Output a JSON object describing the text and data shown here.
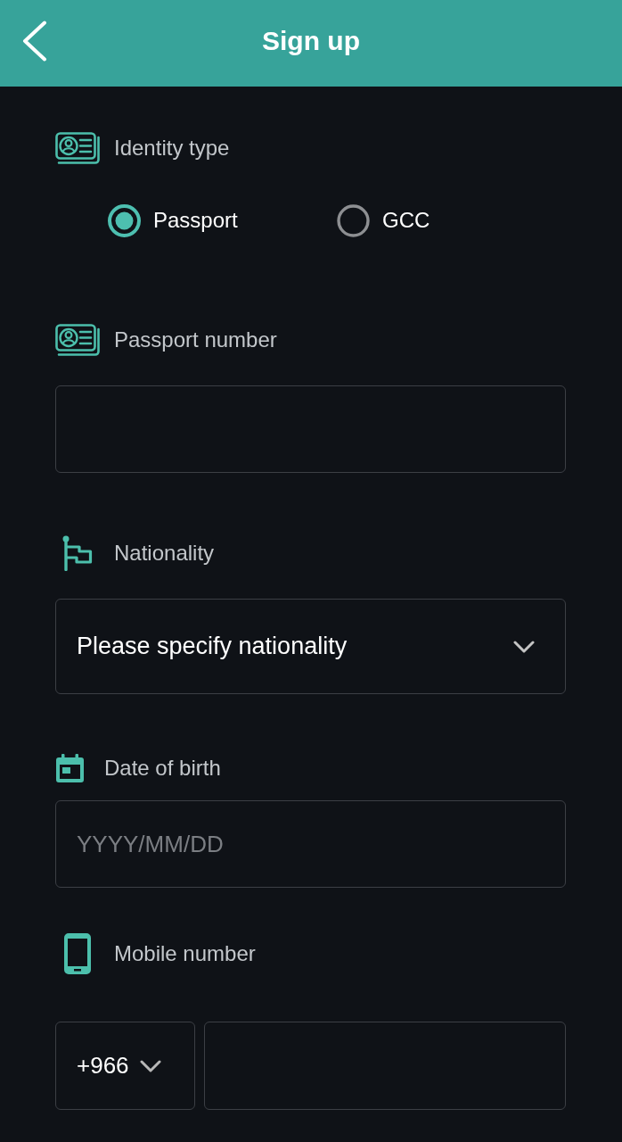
{
  "header": {
    "title": "Sign up"
  },
  "sections": [
    {
      "kind": "radio",
      "label": "Identity type",
      "options": [
        {
          "label": "Passport",
          "selected": true
        },
        {
          "label": "GCC",
          "selected": false
        }
      ]
    },
    {
      "kind": "text",
      "label": "Passport number"
    },
    {
      "kind": "select",
      "label": "Nationality",
      "value": "Please specify nationality"
    },
    {
      "kind": "text",
      "label": "Date of birth",
      "placeholder": "YYYY/MM/DD"
    },
    {
      "kind": "phone",
      "label": "Mobile number",
      "country_code": "+966"
    }
  ]
}
